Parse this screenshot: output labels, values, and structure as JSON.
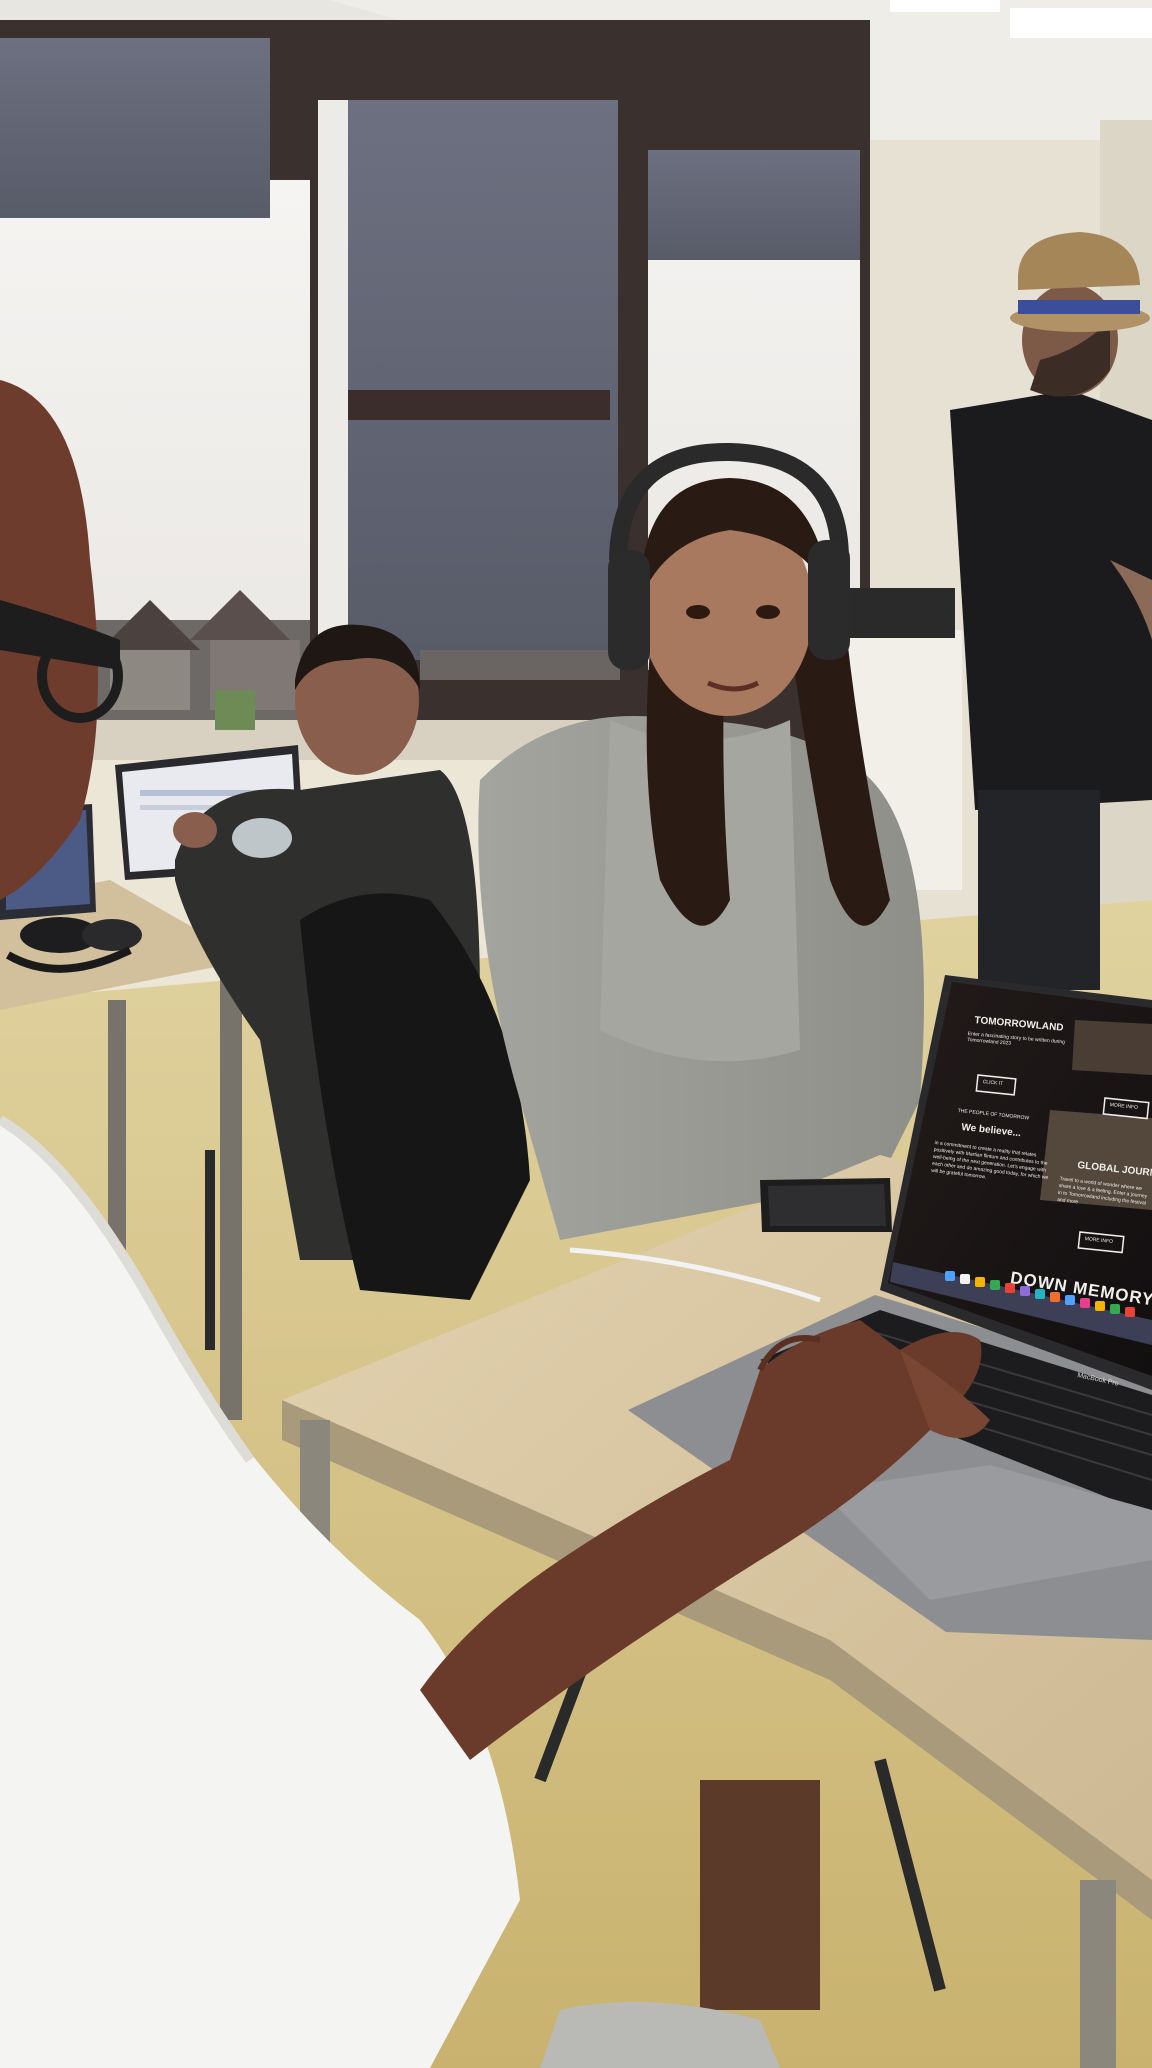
{
  "photo": {
    "colors": {
      "ceiling": "#e9e7e1",
      "wall": "#e7e2d4",
      "sky": "#f3f1ee",
      "window_frame": "#3b2f2e",
      "blind": "#5f6373",
      "floor": "#d9c890",
      "desk_top": "#dccaa8",
      "laptop_body": "#8c8d90",
      "screen_bg": "#1b1616",
      "hoodie": "#9c9c97",
      "shirt_white": "#f4f4f2",
      "shirt_black": "#1b1b1d",
      "skin": "#7a4a3a"
    }
  },
  "laptop_screen": {
    "site_title": "TOMORROWLAND",
    "site_subtitle": "Enter a fascinating story to be written during Tomorrowland 2023",
    "start_button": "CLICK IT",
    "section_kicker": "THE PEOPLE OF TOMORROW",
    "section_heading": "We believe...",
    "section_body": "in a commitment to create a reality that relates positively with Martian flintum and contributes to the well-being of the next generation. Let's engage with each other and do amazing good today, for which we will be grateful tomorrow.",
    "card_button": "MORE INFO",
    "card_title": "GLOBAL JOURNEY",
    "card_body": "Travel to a world of wonder where we share a love & a feeling. Enter a journey in to Tomorrowland including the festival and more",
    "card_button_2": "MORE INFO",
    "banner_heading": "DOWN MEMORY LA",
    "laptop_model": "MacBook Pro"
  }
}
